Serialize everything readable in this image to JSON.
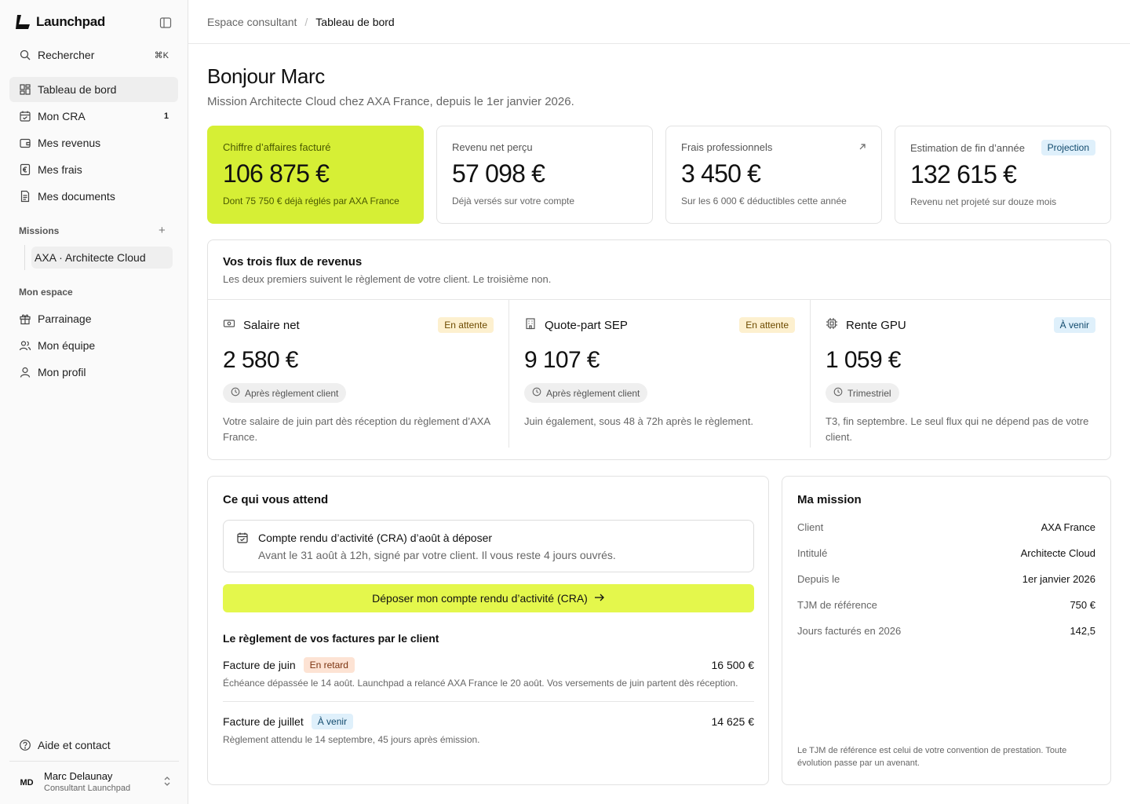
{
  "app": {
    "name": "Launchpad"
  },
  "sidebar": {
    "search": {
      "label": "Rechercher",
      "shortcut": "⌘K"
    },
    "nav": [
      {
        "label": "Tableau de bord",
        "icon": "dashboard-icon",
        "active": true
      },
      {
        "label": "Mon CRA",
        "icon": "calendar-icon",
        "badge": "1"
      },
      {
        "label": "Mes revenus",
        "icon": "wallet-icon"
      },
      {
        "label": "Mes frais",
        "icon": "euro-icon"
      },
      {
        "label": "Mes documents",
        "icon": "document-icon"
      }
    ],
    "missions_label": "Missions",
    "missions": [
      {
        "label": "AXA · Architecte Cloud"
      }
    ],
    "espace_label": "Mon espace",
    "espace": [
      {
        "label": "Parrainage",
        "icon": "gift-icon"
      },
      {
        "label": "Mon équipe",
        "icon": "team-icon"
      },
      {
        "label": "Mon profil",
        "icon": "user-icon"
      }
    ],
    "help": {
      "label": "Aide et contact"
    },
    "user": {
      "initials": "MD",
      "name": "Marc Delaunay",
      "role": "Consultant Launchpad"
    }
  },
  "breadcrumb": {
    "parent": "Espace consultant",
    "current": "Tableau de bord"
  },
  "header": {
    "title": "Bonjour Marc",
    "subtitle": "Mission Architecte Cloud chez AXA France, depuis le 1er janvier 2026."
  },
  "kpis": [
    {
      "label": "Chiffre d’affaires facturé",
      "value": "106 875 €",
      "foot": "Dont 75 750 € déjà réglés par AXA France"
    },
    {
      "label": "Revenu net perçu",
      "value": "57 098 €",
      "foot": "Déjà versés sur votre compte"
    },
    {
      "label": "Frais professionnels",
      "value": "3 450 €",
      "foot": "Sur les 6 000 € déductibles cette année"
    },
    {
      "label": "Estimation de fin d’année",
      "badge": "Projection",
      "value": "132 615 €",
      "foot": "Revenu net projeté sur douze mois"
    }
  ],
  "flux": {
    "title": "Vos trois flux de revenus",
    "subtitle": "Les deux premiers suivent le règlement de votre client. Le troisième non.",
    "items": [
      {
        "name": "Salaire net",
        "badge": "En attente",
        "amount": "2 580 €",
        "pill": "Après règlement client",
        "desc": "Votre salaire de juin part dès réception du règlement d’AXA France."
      },
      {
        "name": "Quote-part SEP",
        "badge": "En attente",
        "amount": "9 107 €",
        "pill": "Après règlement client",
        "desc": "Juin également, sous 48 à 72h après le règlement."
      },
      {
        "name": "Rente GPU",
        "badge": "À venir",
        "amount": "1 059 €",
        "pill": "Trimestriel",
        "desc": "T3, fin septembre. Le seul flux qui ne dépend pas de votre client."
      }
    ]
  },
  "todo": {
    "title": "Ce qui vous attend",
    "task_title": "Compte rendu d’activité (CRA) d’août à déposer",
    "task_sub": "Avant le 31 août à 12h, signé par votre client. Il vous reste 4 jours ouvrés.",
    "cta": "Déposer mon compte rendu d’activité (CRA)",
    "invoices_title": "Le règlement de vos factures par le client",
    "invoices": [
      {
        "name": "Facture de juin",
        "badge": "En retard",
        "amount": "16 500 €",
        "note": "Échéance dépassée le 14 août. Launchpad a relancé AXA France le 20 août. Vos versements de juin partent dès réception."
      },
      {
        "name": "Facture de juillet",
        "badge": "À venir",
        "amount": "14 625 €",
        "note": "Règlement attendu le 14 septembre, 45 jours après émission."
      }
    ]
  },
  "mission": {
    "title": "Ma mission",
    "rows": [
      {
        "k": "Client",
        "v": "AXA France"
      },
      {
        "k": "Intitulé",
        "v": "Architecte Cloud"
      },
      {
        "k": "Depuis le",
        "v": "1er janvier 2026"
      },
      {
        "k": "TJM de référence",
        "v": "750 €"
      },
      {
        "k": "Jours facturés en 2026",
        "v": "142,5"
      }
    ],
    "note": "Le TJM de référence est celui de votre convention de prestation. Toute évolution passe par un avenant."
  },
  "colors": {
    "accent": "#d6ef35",
    "cta": "#e4f74c"
  }
}
